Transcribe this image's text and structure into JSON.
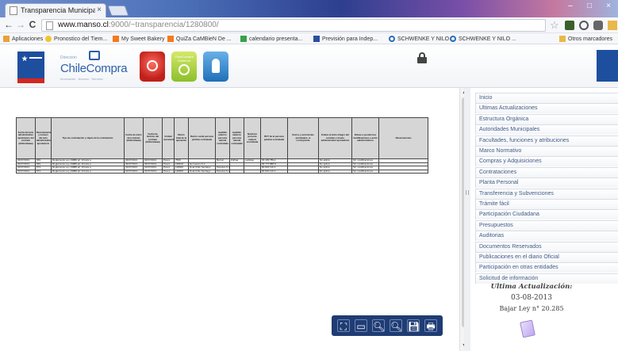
{
  "browser": {
    "tab_title": "Transparencia Municipal",
    "tab_close": "×",
    "url_host": "www.manso.cl",
    "url_rest": ":9000/~transparencia/1280800/",
    "back_glyph": "←",
    "forward_glyph": "→",
    "reload_glyph": "C",
    "star_glyph": "☆",
    "window_controls": [
      "–",
      "□",
      "×"
    ]
  },
  "bookmarks": [
    {
      "label": "Aplicaciones",
      "color": "#e8a33a"
    },
    {
      "label": "Pronostico del Tiem...",
      "color": "#f0c630"
    },
    {
      "label": "My Sweet Bakery",
      "color": "#f47a20"
    },
    {
      "label": "QuiZa CaMBieN De ...",
      "color": "#f47a20"
    },
    {
      "label": "calendario presenta...",
      "color": "#3aa04a"
    },
    {
      "label": "Previsión para Indep...",
      "color": "#2a4fa0"
    },
    {
      "label": "SCHWENKE Y NILO ...",
      "color": "#2a6fb8"
    },
    {
      "label": "SCHWENKE Y NILO ...",
      "color": "#2a6fb8"
    },
    {
      "label": "Otros marcadores",
      "color": "#e8b84a"
    }
  ],
  "header": {
    "chilecompra_small": "Dirección",
    "chilecompra_name": "ChileCompra",
    "chilecompra_tag": "Innovación · Acceso · Servicio",
    "green_app_label": "ChileCompra Gobierno"
  },
  "document": {
    "headers": [
      "Fecha del acto administrativo aprobatorio del contrato (dd/mm/aaaa)",
      "Denominación y número del acto administrativo aprobatorio",
      "Tipo de contratación y objeto de la contratación",
      "Fecha de inicio del contrato (dd/mm/aaaa)",
      "Fecha de término del contrato (dd/mm/aaaa)",
      "Unidad monetaria",
      "Monto total de la operación",
      "Razón social persona jurídica contratada",
      "Apellido paterno persona natural contratada",
      "Apellido materno persona natural contratada",
      "Nombres persona natural contratada",
      "RUT de la persona jurídica contratada",
      "Socios y accionistas principales, si corresponde",
      "Enlace al texto íntegro del contrato y al acto administrativo aprobatorio",
      "Enlace a posteriores modificaciones o actos administrativos",
      "Observaciones"
    ],
    "rows": [
      [
        "04/07/2013",
        "669",
        "Reglamento Ley 19886 art 10 letra a",
        "04/07/2013",
        "04/07/2013",
        "Pesos",
        "7500",
        "",
        "Bernal",
        "Zuñiga",
        "Ladislao",
        "54.345.789-k",
        "",
        "No aplica",
        "Sin modificaciones",
        ""
      ],
      [
        "04/07/2013",
        "669",
        "Reglamento Ley 19886 art 10 letra a",
        "04/07/2013",
        "04/07/2013",
        "Pesos",
        "198100",
        "Hermanos S.A.",
        "",
        "",
        "",
        "96.777.888-8",
        "",
        "No aplica",
        "Sin modificaciones",
        ""
      ],
      [
        "01/07/2013",
        "673",
        "Reglamento Ley 19886 art 10 letra a",
        "01/07/2013",
        "01/07/2013",
        "Pesos",
        "128000",
        "Dual Chile Santiago",
        "Paredes S.A.",
        "",
        "",
        "80.824.116-4",
        "",
        "No aplica",
        "Sin modificaciones",
        ""
      ],
      [
        "01/07/2013",
        "674",
        "Reglamento Ley 19886 art 10 letra a",
        "01/07/2013",
        "01/07/2013",
        "Pesos",
        "128000",
        "Dual Chile Santiago",
        "Paredes S.A.",
        "",
        "",
        "80.824.116-4",
        "",
        "No aplica",
        "Sin modificaciones",
        ""
      ]
    ]
  },
  "pdf_controls": [
    {
      "name": "fit-page-icon",
      "glyph": "⛶"
    },
    {
      "name": "fit-width-icon",
      "glyph": "▭"
    },
    {
      "name": "zoom-out-icon",
      "glyph": "🔍︎"
    },
    {
      "name": "zoom-in-icon",
      "glyph": "🔍︎"
    },
    {
      "name": "save-icon",
      "glyph": "💾︎"
    },
    {
      "name": "print-icon",
      "glyph": "🖶"
    }
  ],
  "sidebar": {
    "items": [
      "Inicio",
      "Ultimas Actualizaciones",
      "Estructura Orgánica",
      "Autoridades Municipales",
      "Facultades, funciones y atribuciones",
      "Marco Normativo",
      "Compras y Adquisiciones",
      "Contrataciones",
      "Planta Personal",
      "Transferencia y Subvenciones",
      "Trámite fácil",
      "Participación Ciudadana",
      "Presupuestos",
      "Auditorias",
      "Documentos Reservados",
      "Publicaciones en el diario Oficial",
      "Participación en otras entidades",
      "Solicitud de información"
    ],
    "update_title": "Ultima Actualización:",
    "update_date": "03-08-2013",
    "law_link": "Bajar Ley n° 20.285"
  }
}
